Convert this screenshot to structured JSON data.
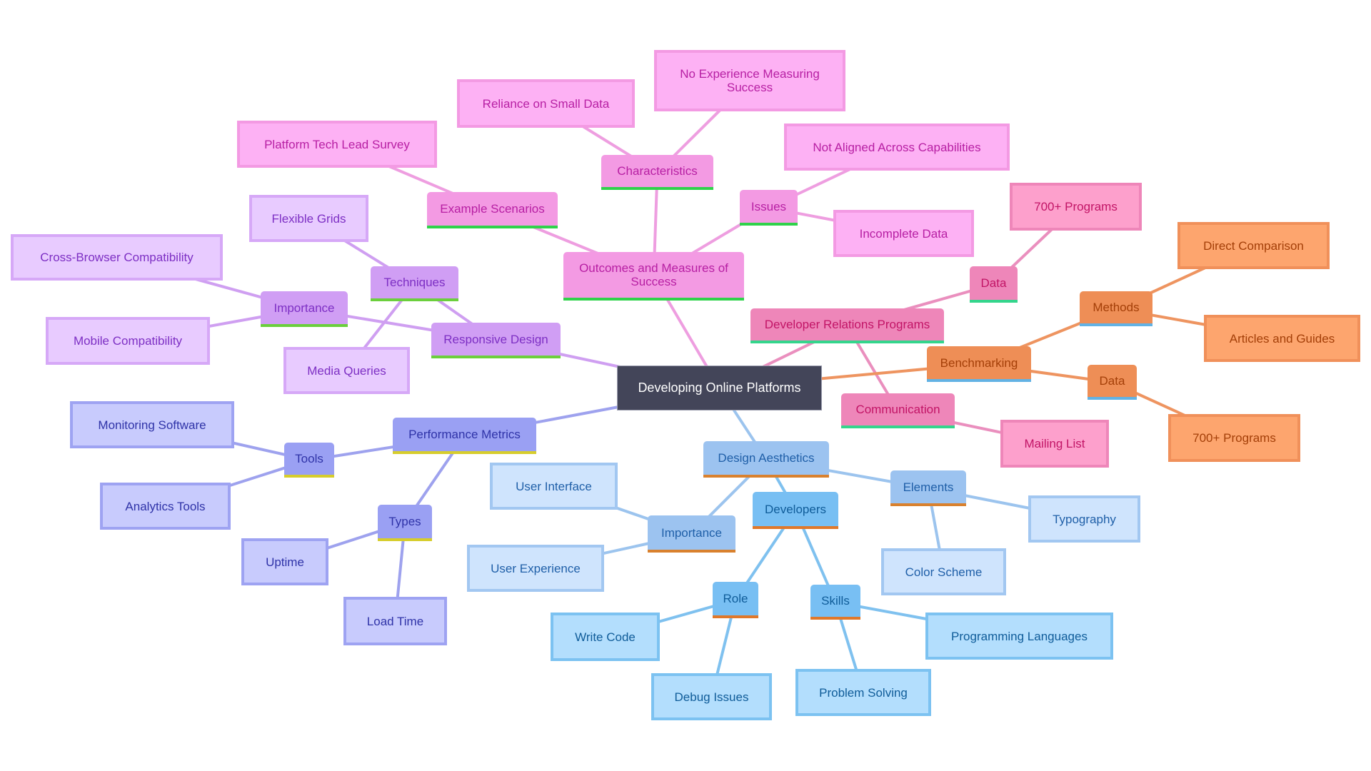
{
  "title": "Developing Online Platforms",
  "root": {
    "id": "root",
    "label": "Developing Online Platforms"
  },
  "palette": {
    "pink": {
      "branch_bg": "#f39ae3",
      "leaf_bg": "#fdb1f4",
      "border": "#f39ae3",
      "text": "#b71fa3",
      "edge": "#ee9ee0",
      "underline": "#2fd24a"
    },
    "purple": {
      "branch_bg": "#d09ef4",
      "leaf_bg": "#e8cbff",
      "border": "#d6a8f7",
      "text": "#7d2fc4",
      "edge": "#cf9ff1",
      "underline": "#6bcf3c"
    },
    "indigo": {
      "branch_bg": "#9aa0f3",
      "leaf_bg": "#c8cbfd",
      "border": "#9ea3f2",
      "text": "#2f33a8",
      "edge": "#9ea2ee",
      "underline": "#d7cd2c"
    },
    "blue": {
      "branch_bg": "#9cc3f0",
      "leaf_bg": "#cfe4fd",
      "border": "#a2c7f1",
      "text": "#1f5fa8",
      "edge": "#9cc4ee",
      "underline": "#d9812e"
    },
    "sky": {
      "branch_bg": "#78bff3",
      "leaf_bg": "#b3defd",
      "border": "#7cc2f1",
      "text": "#0f5c99",
      "edge": "#7fc1ef",
      "underline": "#e0782a"
    },
    "rose": {
      "branch_bg": "#ee86b9",
      "leaf_bg": "#fda0cc",
      "border": "#ee86b9",
      "text": "#c21466",
      "edge": "#ea8fbe",
      "underline": "#34d58c"
    },
    "orange": {
      "branch_bg": "#ee8e56",
      "leaf_bg": "#fda56e",
      "border": "#f0905a",
      "text": "#a43f08",
      "edge": "#ee9460",
      "underline": "#62b2e4"
    }
  },
  "nodes": [
    {
      "id": "outcomes",
      "label": "Outcomes and Measures of Success",
      "parent": "root",
      "kind": "branch",
      "color": "pink"
    },
    {
      "id": "characteristics",
      "label": "Characteristics",
      "parent": "outcomes",
      "kind": "branch",
      "color": "pink"
    },
    {
      "id": "no-experience",
      "label": "No Experience Measuring Success",
      "parent": "characteristics",
      "kind": "leaf",
      "color": "pink"
    },
    {
      "id": "reliance",
      "label": "Reliance on Small Data",
      "parent": "characteristics",
      "kind": "leaf",
      "color": "pink"
    },
    {
      "id": "example-scenarios",
      "label": "Example Scenarios",
      "parent": "outcomes",
      "kind": "branch",
      "color": "pink"
    },
    {
      "id": "tech-lead-survey",
      "label": "Platform Tech Lead Survey",
      "parent": "example-scenarios",
      "kind": "leaf",
      "color": "pink"
    },
    {
      "id": "issues",
      "label": "Issues",
      "parent": "outcomes",
      "kind": "branch",
      "color": "pink"
    },
    {
      "id": "not-aligned",
      "label": "Not Aligned Across Capabilities",
      "parent": "issues",
      "kind": "leaf",
      "color": "pink"
    },
    {
      "id": "incomplete-data",
      "label": "Incomplete Data",
      "parent": "issues",
      "kind": "leaf",
      "color": "pink"
    },
    {
      "id": "responsive-design",
      "label": "Responsive Design",
      "parent": "root",
      "kind": "branch",
      "color": "purple"
    },
    {
      "id": "techniques",
      "label": "Techniques",
      "parent": "responsive-design",
      "kind": "branch",
      "color": "purple"
    },
    {
      "id": "flexible-grids",
      "label": "Flexible Grids",
      "parent": "techniques",
      "kind": "leaf",
      "color": "purple"
    },
    {
      "id": "media-queries",
      "label": "Media Queries",
      "parent": "techniques",
      "kind": "leaf",
      "color": "purple"
    },
    {
      "id": "importance-rd",
      "label": "Importance",
      "parent": "responsive-design",
      "kind": "branch",
      "color": "purple"
    },
    {
      "id": "cross-browser",
      "label": "Cross-Browser Compatibility",
      "parent": "importance-rd",
      "kind": "leaf",
      "color": "purple"
    },
    {
      "id": "mobile-compat",
      "label": "Mobile Compatibility",
      "parent": "importance-rd",
      "kind": "leaf",
      "color": "purple"
    },
    {
      "id": "performance-metrics",
      "label": "Performance Metrics",
      "parent": "root",
      "kind": "branch",
      "color": "indigo"
    },
    {
      "id": "tools",
      "label": "Tools",
      "parent": "performance-metrics",
      "kind": "branch",
      "color": "indigo"
    },
    {
      "id": "monitoring-software",
      "label": "Monitoring Software",
      "parent": "tools",
      "kind": "leaf",
      "color": "indigo"
    },
    {
      "id": "analytics-tools",
      "label": "Analytics Tools",
      "parent": "tools",
      "kind": "leaf",
      "color": "indigo"
    },
    {
      "id": "types",
      "label": "Types",
      "parent": "performance-metrics",
      "kind": "branch",
      "color": "indigo"
    },
    {
      "id": "uptime",
      "label": "Uptime",
      "parent": "types",
      "kind": "leaf",
      "color": "indigo"
    },
    {
      "id": "load-time",
      "label": "Load Time",
      "parent": "types",
      "kind": "leaf",
      "color": "indigo"
    },
    {
      "id": "design-aesthetics",
      "label": "Design Aesthetics",
      "parent": "root",
      "kind": "branch",
      "color": "blue"
    },
    {
      "id": "importance-da",
      "label": "Importance",
      "parent": "design-aesthetics",
      "kind": "branch",
      "color": "blue"
    },
    {
      "id": "user-interface",
      "label": "User Interface",
      "parent": "importance-da",
      "kind": "leaf",
      "color": "blue"
    },
    {
      "id": "user-experience",
      "label": "User Experience",
      "parent": "importance-da",
      "kind": "leaf",
      "color": "blue"
    },
    {
      "id": "elements",
      "label": "Elements",
      "parent": "design-aesthetics",
      "kind": "branch",
      "color": "blue"
    },
    {
      "id": "typography",
      "label": "Typography",
      "parent": "elements",
      "kind": "leaf",
      "color": "blue"
    },
    {
      "id": "color-scheme",
      "label": "Color Scheme",
      "parent": "elements",
      "kind": "leaf",
      "color": "blue"
    },
    {
      "id": "developers",
      "label": "Developers",
      "parent": "design-aesthetics",
      "kind": "branch",
      "color": "sky"
    },
    {
      "id": "role",
      "label": "Role",
      "parent": "developers",
      "kind": "branch",
      "color": "sky"
    },
    {
      "id": "write-code",
      "label": "Write Code",
      "parent": "role",
      "kind": "leaf",
      "color": "sky"
    },
    {
      "id": "debug-issues",
      "label": "Debug Issues",
      "parent": "role",
      "kind": "leaf",
      "color": "sky"
    },
    {
      "id": "skills",
      "label": "Skills",
      "parent": "developers",
      "kind": "branch",
      "color": "sky"
    },
    {
      "id": "problem-solving",
      "label": "Problem Solving",
      "parent": "skills",
      "kind": "leaf",
      "color": "sky"
    },
    {
      "id": "programming-languages",
      "label": "Programming Languages",
      "parent": "skills",
      "kind": "leaf",
      "color": "sky"
    },
    {
      "id": "devrel-programs",
      "label": "Developer Relations Programs",
      "parent": "root",
      "kind": "branch",
      "color": "rose"
    },
    {
      "id": "data-devrel",
      "label": "Data",
      "parent": "devrel-programs",
      "kind": "branch",
      "color": "rose"
    },
    {
      "id": "programs-700-devrel",
      "label": "700+ Programs",
      "parent": "data-devrel",
      "kind": "leaf",
      "color": "rose"
    },
    {
      "id": "communication",
      "label": "Communication",
      "parent": "devrel-programs",
      "kind": "branch",
      "color": "rose"
    },
    {
      "id": "mailing-list",
      "label": "Mailing List",
      "parent": "communication",
      "kind": "leaf",
      "color": "rose"
    },
    {
      "id": "benchmarking",
      "label": "Benchmarking",
      "parent": "root",
      "kind": "branch",
      "color": "orange"
    },
    {
      "id": "methods",
      "label": "Methods",
      "parent": "benchmarking",
      "kind": "branch",
      "color": "orange"
    },
    {
      "id": "direct-comparison",
      "label": "Direct Comparison",
      "parent": "methods",
      "kind": "leaf",
      "color": "orange"
    },
    {
      "id": "articles-guides",
      "label": "Articles and Guides",
      "parent": "methods",
      "kind": "leaf",
      "color": "orange"
    },
    {
      "id": "data-bench",
      "label": "Data",
      "parent": "benchmarking",
      "kind": "branch",
      "color": "orange"
    },
    {
      "id": "programs-700-bench",
      "label": "700+ Programs",
      "parent": "data-bench",
      "kind": "leaf",
      "color": "orange"
    }
  ]
}
